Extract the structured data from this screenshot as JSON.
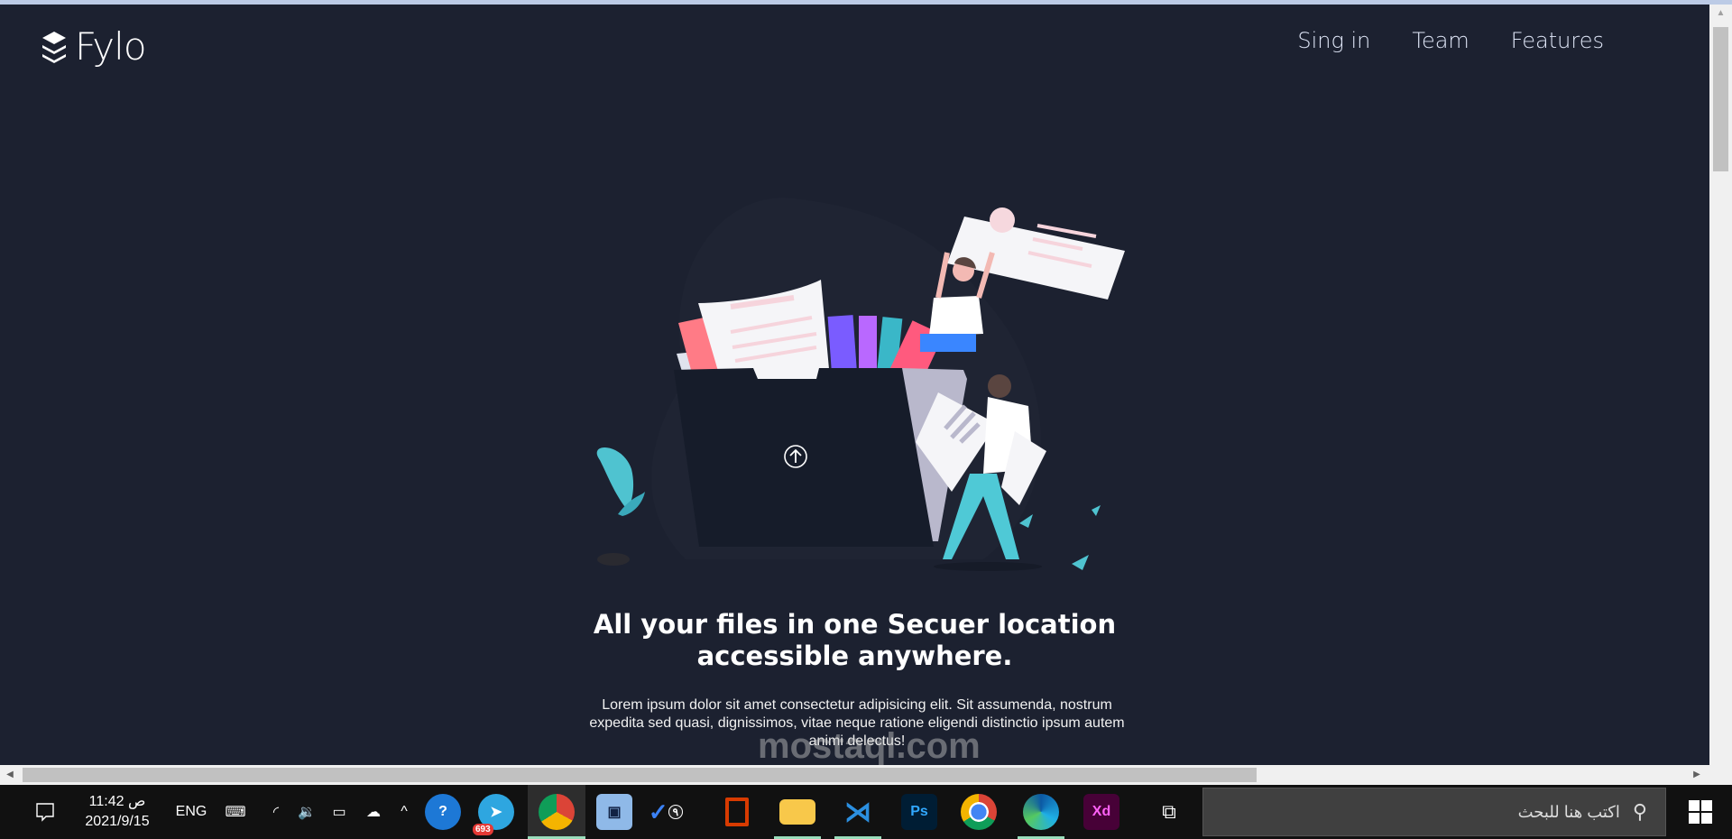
{
  "header": {
    "logo_text": "Fylo",
    "nav": [
      {
        "label": "Sing in"
      },
      {
        "label": "Team"
      },
      {
        "label": "Features"
      }
    ]
  },
  "hero": {
    "title_line1": "All your files in one Secuer location",
    "title_line2": "accessible anywhere.",
    "paragraph": "Lorem ipsum dolor sit amet consectetur adipisicing elit. Sit assumenda, nostrum expedita sed quasi, dignissimos, vitae neque ratione eligendi distinctio ipsum autem animi delectus!"
  },
  "watermark": "mostaql.com",
  "taskbar": {
    "time": "11:42 ص",
    "date": "2021/9/15",
    "language": "ENG",
    "telegram_badge": "693",
    "todo_badge": "٩",
    "search_placeholder": "اكتب هنا للبحث",
    "apps": [
      "help-icon",
      "telegram-icon",
      "chrome-profile-icon",
      "virtualbox-icon",
      "todo-icon",
      "office-icon",
      "file-explorer-icon",
      "vscode-icon",
      "photoshop-icon",
      "chrome-icon",
      "edge-icon",
      "xd-icon",
      "task-view-icon"
    ],
    "ps_label": "Ps",
    "xd_label": "Xd"
  },
  "colors": {
    "background": "#1c2130",
    "accent_teal": "#4fc3d0",
    "taskbar": "#111111"
  }
}
